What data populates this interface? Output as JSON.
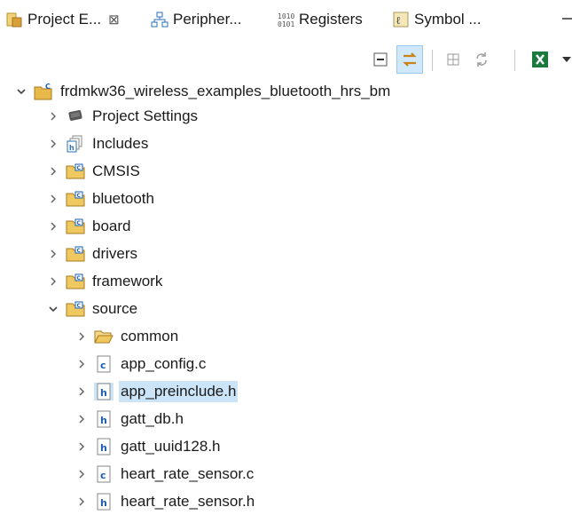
{
  "tabs": [
    {
      "label": "Project E...",
      "close": "⊠"
    },
    {
      "label": "Peripher..."
    },
    {
      "label": "Registers"
    },
    {
      "label": "Symbol ..."
    }
  ],
  "tree": {
    "root": "frdmkw36_wireless_examples_bluetooth_hrs_bm",
    "items": [
      {
        "label": "Project Settings"
      },
      {
        "label": "Includes"
      },
      {
        "label": "CMSIS"
      },
      {
        "label": "bluetooth"
      },
      {
        "label": "board"
      },
      {
        "label": "drivers"
      },
      {
        "label": "framework"
      },
      {
        "label": "source"
      },
      {
        "label": "common"
      },
      {
        "label": "app_config.c"
      },
      {
        "label": "app_preinclude.h"
      },
      {
        "label": "gatt_db.h"
      },
      {
        "label": "gatt_uuid128.h"
      },
      {
        "label": "heart_rate_sensor.c"
      },
      {
        "label": "heart_rate_sensor.h"
      }
    ]
  },
  "colors": {
    "folder": "#e8b84a",
    "selection": "#cce4f7",
    "sync_active": "#cfe8fc"
  }
}
